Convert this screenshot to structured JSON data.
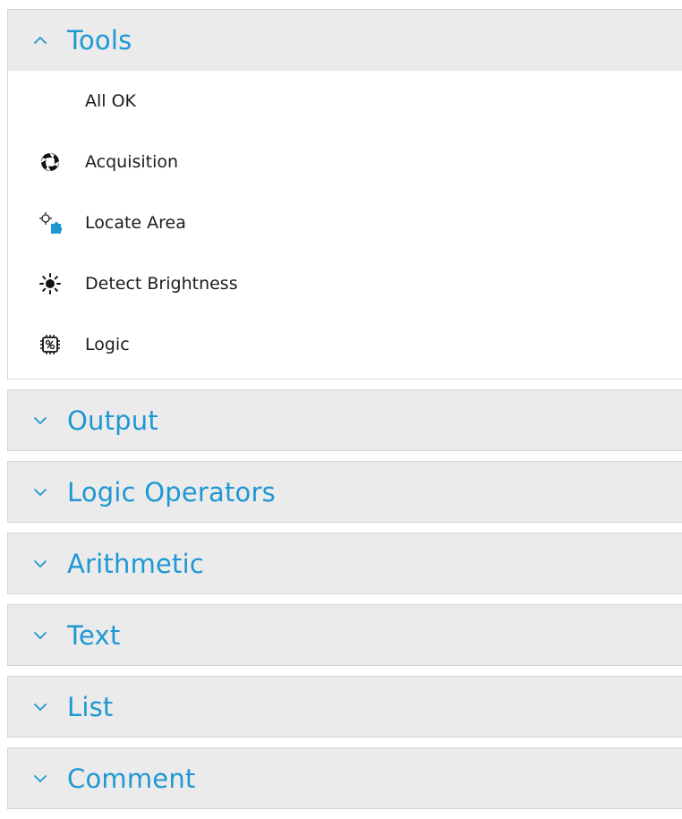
{
  "toolbox": {
    "sections": [
      {
        "title": "Tools",
        "expanded": true,
        "items": [
          {
            "label": "All OK",
            "icon": "none"
          },
          {
            "label": "Acquisition",
            "icon": "aperture-icon"
          },
          {
            "label": "Locate Area",
            "icon": "locate-area-icon"
          },
          {
            "label": "Detect Brightness",
            "icon": "sun-icon"
          },
          {
            "label": "Logic",
            "icon": "logic-chip-icon"
          }
        ]
      },
      {
        "title": "Output",
        "expanded": false
      },
      {
        "title": "Logic Operators",
        "expanded": false
      },
      {
        "title": "Arithmetic",
        "expanded": false
      },
      {
        "title": "Text",
        "expanded": false
      },
      {
        "title": "List",
        "expanded": false
      },
      {
        "title": "Comment",
        "expanded": false
      }
    ]
  },
  "colors": {
    "header_background": "#ebebeb",
    "header_text": "#1e98d3",
    "item_text": "#1c1c1c",
    "border": "#d5d5d5",
    "icon_accent": "#1e98d3"
  }
}
